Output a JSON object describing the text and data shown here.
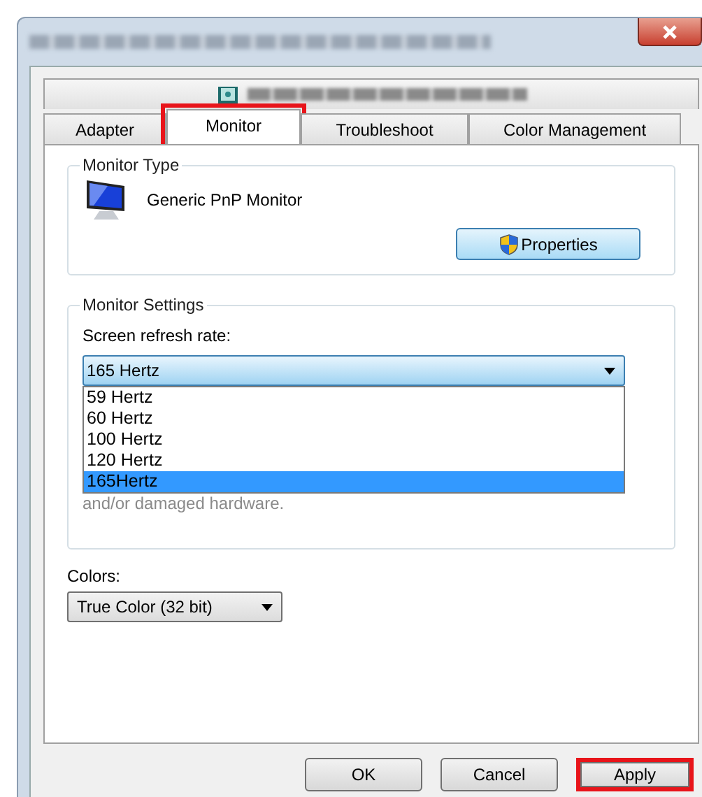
{
  "tabs_top": [
    {
      "kind": "blurred",
      "selected": false
    }
  ],
  "tabs": [
    {
      "label": "Adapter",
      "selected": false,
      "highlighted": false
    },
    {
      "label": "Monitor",
      "selected": true,
      "highlighted": true
    },
    {
      "label": "Troubleshoot",
      "selected": false,
      "highlighted": false
    },
    {
      "label": "Color Management",
      "selected": false,
      "highlighted": false
    }
  ],
  "monitor_type": {
    "title": "Monitor Type",
    "name": "Generic PnP Monitor",
    "properties_button": "Properties"
  },
  "monitor_settings": {
    "title": "Monitor Settings",
    "refresh_label": "Screen refresh rate:",
    "refresh_value": "165 Hertz",
    "options": [
      {
        "label": "59 Hertz",
        "selected": false
      },
      {
        "label": "60 Hertz",
        "selected": false
      },
      {
        "label": "100 Hertz",
        "selected": false
      },
      {
        "label": "120 Hertz",
        "selected": false
      },
      {
        "label": "165Hertz",
        "selected": true
      }
    ],
    "note": "and/or damaged hardware."
  },
  "colors": {
    "label": "Colors:",
    "value": "True Color (32 bit)"
  },
  "buttons": [
    {
      "label": "OK",
      "highlighted": false
    },
    {
      "label": "Cancel",
      "highlighted": false
    },
    {
      "label": "Apply",
      "highlighted": true
    }
  ]
}
